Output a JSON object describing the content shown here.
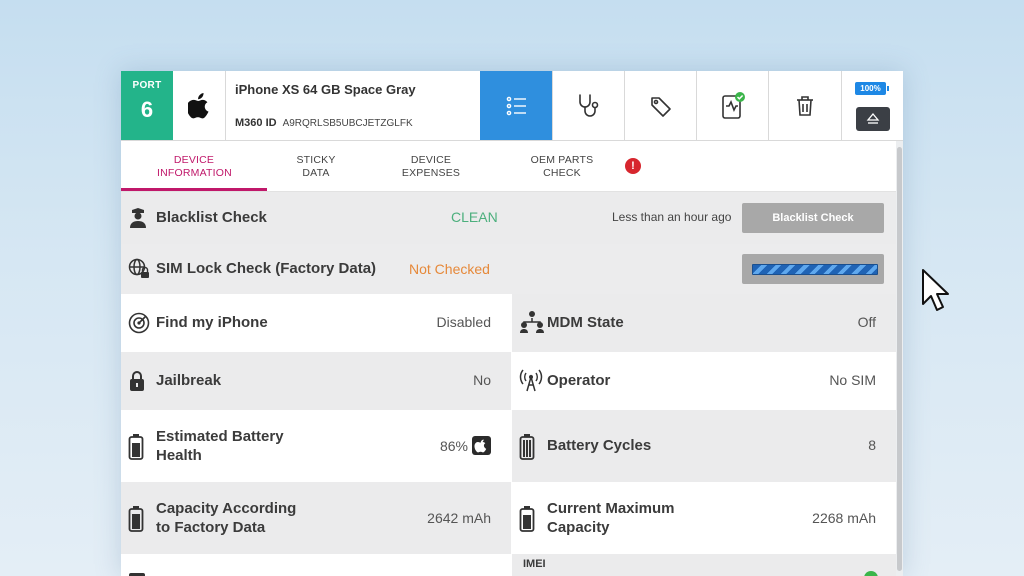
{
  "header": {
    "port_label": "PORT",
    "port_number": "6",
    "device_name": "iPhone XS 64 GB Space Gray",
    "id_label": "M360 ID",
    "id_value": "A9RQRLSB5UBCJETZGLFK",
    "battery_level": "100%",
    "icons": [
      "list-icon",
      "stethoscope-icon",
      "tag-icon",
      "clipboard-check-icon",
      "trash-icon",
      "eject-icon"
    ]
  },
  "tabs": [
    {
      "label_line1": "DEVICE",
      "label_line2": "INFORMATION",
      "active": true
    },
    {
      "label_line1": "STICKY",
      "label_line2": "DATA"
    },
    {
      "label_line1": "DEVICE",
      "label_line2": "EXPENSES"
    },
    {
      "label_line1": "OEM PARTS",
      "label_line2": "CHECK",
      "alert": "!"
    }
  ],
  "checks": {
    "blacklist": {
      "label": "Blacklist Check",
      "status": "CLEAN",
      "time": "Less than an hour ago",
      "button": "Blacklist Check"
    },
    "simlock": {
      "label": "SIM Lock Check (Factory Data)",
      "status": "Not Checked"
    }
  },
  "info": {
    "find_my_iphone": {
      "label": "Find my iPhone",
      "value": "Disabled"
    },
    "mdm_state": {
      "label": "MDM State",
      "value": "Off"
    },
    "jailbreak": {
      "label": "Jailbreak",
      "value": "No"
    },
    "operator": {
      "label": "Operator",
      "value": "No SIM"
    },
    "battery_health": {
      "label_line1": "Estimated Battery",
      "label_line2": "Health",
      "value": "86%"
    },
    "battery_cycles": {
      "label": "Battery Cycles",
      "value": "8"
    },
    "capacity_factory": {
      "label_line1": "Capacity According",
      "label_line2": "to Factory Data",
      "value": "2642 mAh"
    },
    "current_capacity": {
      "label_line1": "Current Maximum",
      "label_line2": "Capacity",
      "value": "2268 mAh"
    },
    "imei_label": "IMEI"
  },
  "colors": {
    "port_green": "#23b48a",
    "active_blue": "#2f8fde",
    "tab_active": "#c0186a",
    "clean_green": "#4caf7d",
    "not_checked_orange": "#e6893a"
  }
}
